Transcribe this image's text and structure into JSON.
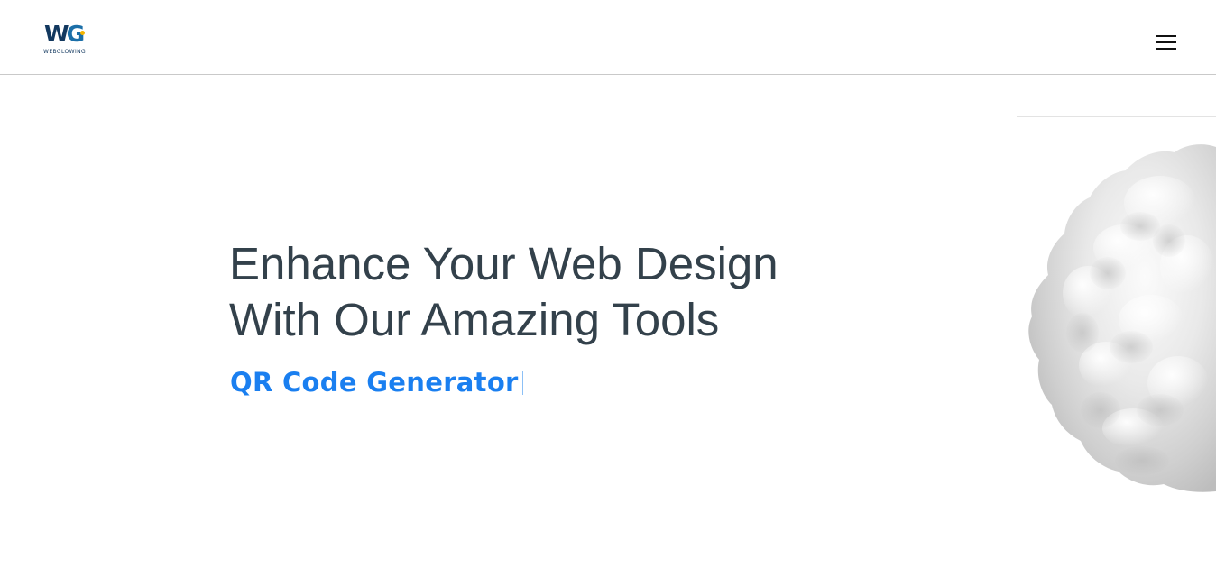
{
  "brand": {
    "logo_mark": "WG",
    "logo_text": "WEBGLOWING"
  },
  "nav": {
    "menu_icon": "hamburger-menu-icon"
  },
  "hero": {
    "title_line1": "Enhance Your Web Design",
    "title_line2": "With Our Amazing Tools",
    "typed_text": "QR Code Generator",
    "image": "3d-sphere-graphic"
  },
  "colors": {
    "title": "#33414b",
    "accent": "#1a7ff0",
    "logo": "#12385f",
    "header_border": "#c9c9c9"
  }
}
